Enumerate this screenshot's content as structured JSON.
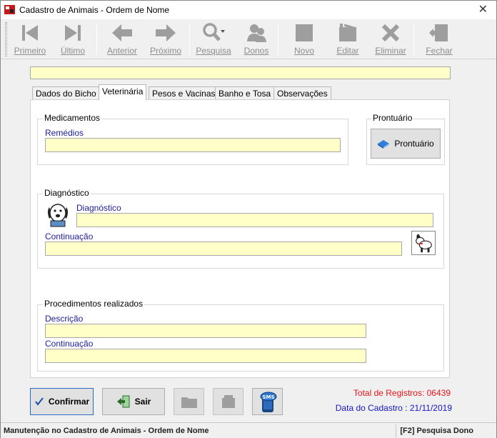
{
  "window": {
    "title": "Cadastro de Animais - Ordem de Nome",
    "close_glyph": "✕"
  },
  "toolbar": {
    "buttons": [
      {
        "label": "Primeiro",
        "icon": "first-icon"
      },
      {
        "label": "Último",
        "icon": "last-icon"
      },
      {
        "label": "Anterior",
        "icon": "previous-icon"
      },
      {
        "label": "Próximo",
        "icon": "next-icon"
      },
      {
        "label": "Pesquisa",
        "icon": "search-icon"
      },
      {
        "label": "Donos",
        "icon": "owners-icon"
      },
      {
        "label": "Novo",
        "icon": "new-icon"
      },
      {
        "label": "Editar",
        "icon": "edit-icon"
      },
      {
        "label": "Eliminar",
        "icon": "delete-icon"
      },
      {
        "label": "Fechar",
        "icon": "close-icon"
      }
    ]
  },
  "top_field": {
    "value": ""
  },
  "tabs": [
    {
      "label": "Dados do Bicho"
    },
    {
      "label": "Veterinária",
      "active": true
    },
    {
      "label": "Pesos e Vacinas"
    },
    {
      "label": "Banho e Tosa"
    },
    {
      "label": "Observações"
    }
  ],
  "medicamentos": {
    "title": "Medicamentos",
    "remedios_label": "Remédios",
    "remedios_value": ""
  },
  "prontuario": {
    "title": "Prontuário",
    "button_label": "Prontuário"
  },
  "diagnostico": {
    "title": "Diagnóstico",
    "diag_label": "Diagnóstico",
    "diag_value": "",
    "cont_label": "Continuação",
    "cont_value": ""
  },
  "procedimentos": {
    "title": "Procedimentos realizados",
    "desc_label": "Descrição",
    "desc_value": "",
    "cont_label": "Continuação",
    "cont_value": ""
  },
  "actions": {
    "confirm_label": "Confirmar",
    "exit_label": "Sair",
    "sms_label": "SMS"
  },
  "info": {
    "total_registros": "Total de Registros: 06439",
    "data_cadastro": "Data do Cadastro : 21/11/2019",
    "total_color": "#e8141b",
    "date_color": "#1414c8"
  },
  "status": {
    "left": "Manutenção no Cadastro de Animais - Ordem de Nome",
    "right": "[F2] Pesquisa Dono"
  }
}
